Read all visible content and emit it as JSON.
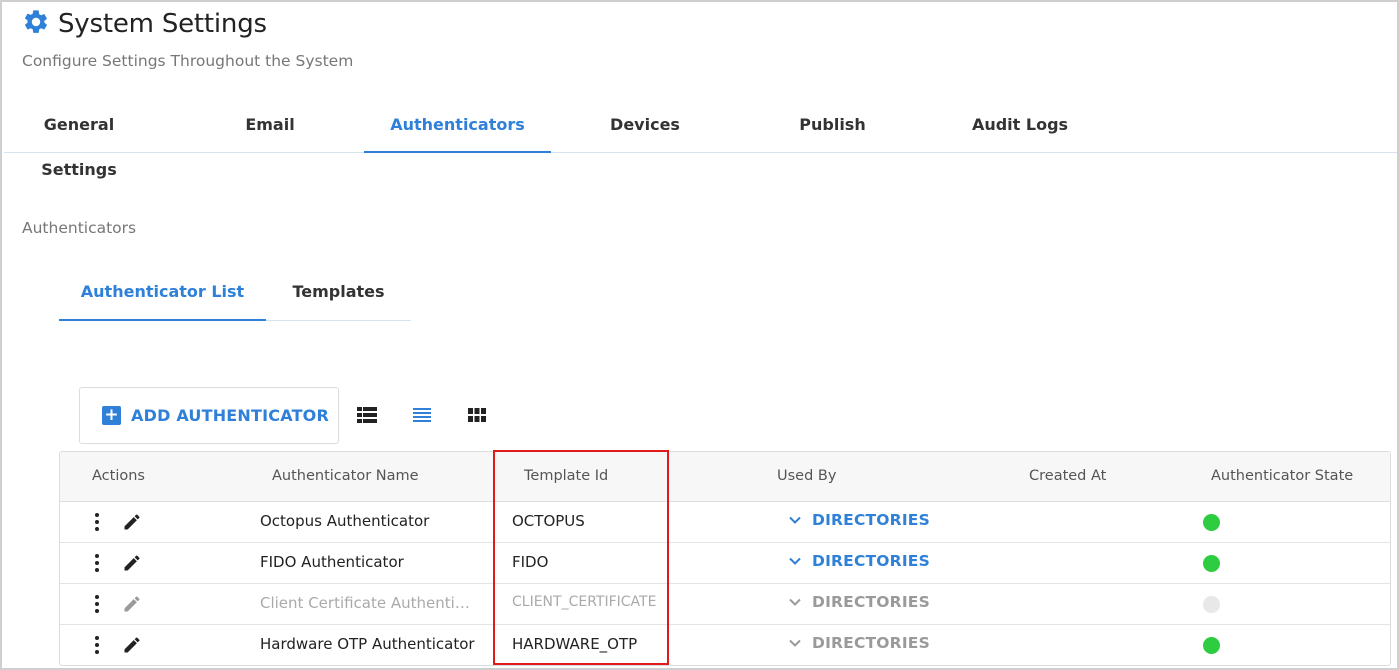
{
  "header": {
    "title": "System Settings",
    "subtitle": "Configure Settings Throughout the System",
    "icon": "gear-icon"
  },
  "main_tabs": [
    {
      "label": "General Settings",
      "active": false
    },
    {
      "label": "Email",
      "active": false
    },
    {
      "label": "Authenticators",
      "active": true
    },
    {
      "label": "Devices",
      "active": false
    },
    {
      "label": "Publish",
      "active": false
    },
    {
      "label": "Audit Logs",
      "active": false
    }
  ],
  "section": {
    "label": "Authenticators"
  },
  "sub_tabs": [
    {
      "label": "Authenticator List",
      "active": true
    },
    {
      "label": "Templates",
      "active": false
    }
  ],
  "toolbar": {
    "add_label": "ADD AUTHENTICATOR",
    "views": [
      "table-view-icon",
      "list-view-icon",
      "grid-view-icon"
    ],
    "active_view": "list-view-icon"
  },
  "table": {
    "columns": [
      "Actions",
      "Authenticator Name",
      "Template Id",
      "Used By",
      "Created At",
      "Authenticator State"
    ],
    "rows": [
      {
        "name": "Octopus Authenticator",
        "template_id": "OCTOPUS",
        "used_by": "DIRECTORIES",
        "created_at": "",
        "state": "active",
        "disabled": false
      },
      {
        "name": "FIDO Authenticator",
        "template_id": "FIDO",
        "used_by": "DIRECTORIES",
        "created_at": "",
        "state": "active",
        "disabled": false
      },
      {
        "name": "Client Certificate Authentic…",
        "template_id": "CLIENT_CERTIFICATE",
        "used_by": "DIRECTORIES",
        "created_at": "",
        "state": "inactive",
        "disabled": true
      },
      {
        "name": "Hardware OTP Authenticator",
        "template_id": "HARDWARE_OTP",
        "used_by": "DIRECTORIES",
        "created_at": "",
        "state": "active",
        "disabled": false
      }
    ]
  },
  "colors": {
    "accent": "#2f80d8",
    "active_state": "#2ecc40",
    "inactive_state": "#e8e8e8",
    "highlight": "#e0191b"
  }
}
